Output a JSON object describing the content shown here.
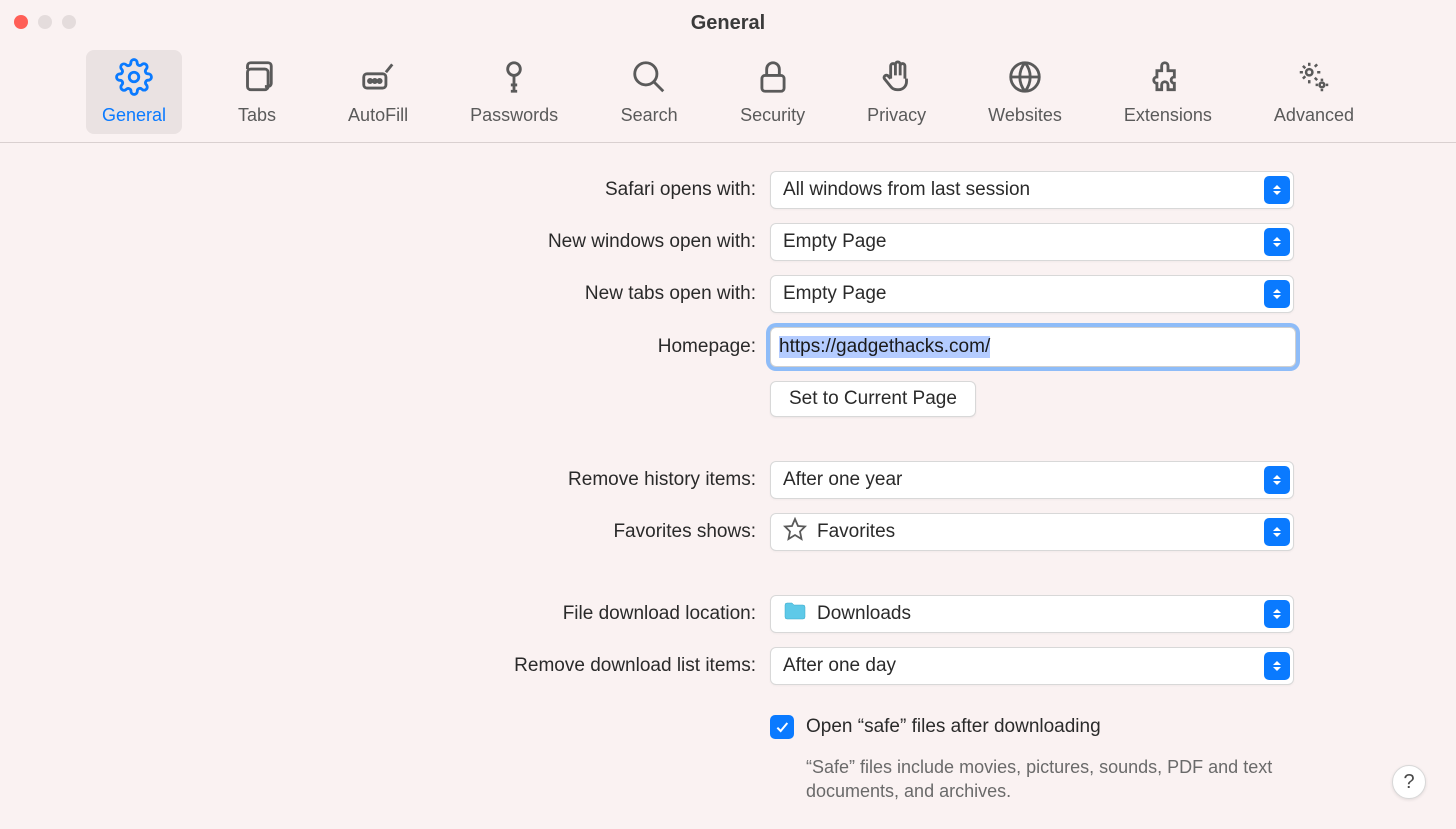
{
  "window": {
    "title": "General"
  },
  "tabs": {
    "general": "General",
    "tabs": "Tabs",
    "autofill": "AutoFill",
    "passwords": "Passwords",
    "search": "Search",
    "security": "Security",
    "privacy": "Privacy",
    "websites": "Websites",
    "extensions": "Extensions",
    "advanced": "Advanced"
  },
  "labels": {
    "safari_opens_with": "Safari opens with:",
    "new_windows_open_with": "New windows open with:",
    "new_tabs_open_with": "New tabs open with:",
    "homepage": "Homepage:",
    "set_to_current_page": "Set to Current Page",
    "remove_history": "Remove history items:",
    "favorites_shows": "Favorites shows:",
    "file_download_location": "File download location:",
    "remove_download_list": "Remove download list items:",
    "open_safe_files": "Open “safe” files after downloading",
    "safe_desc": "“Safe” files include movies, pictures, sounds, PDF and text documents, and archives."
  },
  "values": {
    "safari_opens_with": "All windows from last session",
    "new_windows_open_with": "Empty Page",
    "new_tabs_open_with": "Empty Page",
    "homepage": "https://gadgethacks.com/",
    "remove_history": "After one year",
    "favorites_shows": "Favorites",
    "file_download_location": "Downloads",
    "remove_download_list": "After one day"
  },
  "help": "?"
}
